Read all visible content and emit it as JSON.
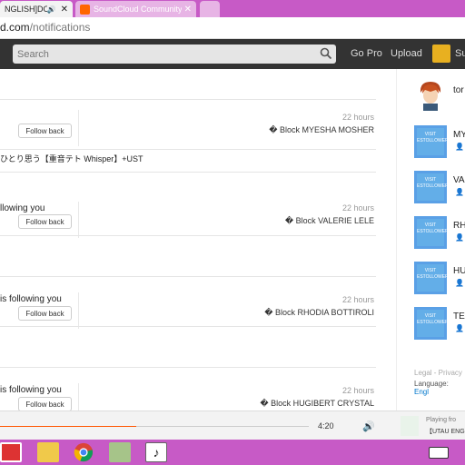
{
  "browser": {
    "tabs": [
      {
        "label": "NGLISH]DOLL",
        "active": true
      },
      {
        "label": "SoundCloud Community",
        "active": false
      },
      {
        "label": "",
        "active": false
      }
    ],
    "url_domain": "d.com",
    "url_path": "/notifications"
  },
  "header": {
    "search_placeholder": "Search",
    "go_pro": "Go Pro",
    "upload": "Upload",
    "username_fragment": "Su"
  },
  "notifications": [
    {
      "text": "",
      "time": "22 hours",
      "follow_back": "Follow back",
      "block": "� Block MYESHA MOSHER"
    },
    {
      "text": "ひとり思う【重音テト Whisper】+UST",
      "time": "",
      "follow_back": "",
      "block": ""
    },
    {
      "text": "llowing you",
      "time": "22 hours",
      "follow_back": "Follow back",
      "block": "� Block VALERIE LELE"
    },
    {
      "text": "is following you",
      "time": "22 hours",
      "follow_back": "Follow back",
      "block": "� Block RHODIA BOTTIROLI"
    },
    {
      "text": "is following you",
      "time": "22 hours",
      "follow_back": "Follow back",
      "block": "� Block HUGIBERT CRYSTAL"
    }
  ],
  "sidebar": {
    "top_user": "tor",
    "suggestions": [
      {
        "name": "MY",
        "badge_line1": "VISIT",
        "badge_line2": "ESTOLLOWERS.SITE"
      },
      {
        "name": "VA",
        "badge_line1": "VISIT",
        "badge_line2": "ESTOLLOWERS.SITE"
      },
      {
        "name": "RH",
        "badge_line1": "VISIT",
        "badge_line2": "ESTOLLOWERS.SITE"
      },
      {
        "name": "HU",
        "badge_line1": "VISIT",
        "badge_line2": "ESTOLLOWERS.SITE"
      },
      {
        "name": "TE",
        "badge_line1": "VISIT",
        "badge_line2": "ESTOLLOWERS.SITE"
      }
    ],
    "legal": "Legal - Privacy",
    "language_label": "Language:",
    "language_value": "Engl"
  },
  "player": {
    "time": "4:20",
    "progress_fraction": 0.44,
    "playing_from": "Playing fro",
    "track": "【UTAU ENG"
  },
  "colors": {
    "accent": "#ff5500",
    "taskbar": "#c75ac6",
    "header_bg": "#333333"
  }
}
